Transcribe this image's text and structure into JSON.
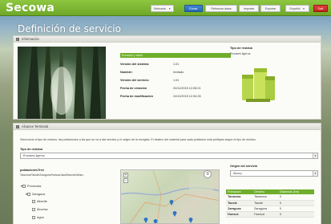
{
  "app": {
    "logo": "Secowa",
    "user_select": "Selección",
    "buttons": {
      "enviar": "Enviar",
      "refrescar": "Refrescar datos",
      "importar": "Importar",
      "exportar": "Exportar",
      "salir": "Salir"
    },
    "language": "Español"
  },
  "page": {
    "title": "Definición de servicio"
  },
  "info_panel": {
    "header": "Información",
    "highlight_row": "Envases y vidrio",
    "rows": [
      {
        "label": "Versión del sistema",
        "value": "1.01"
      },
      {
        "label": "Nombre:",
        "value": "Invitado"
      },
      {
        "label": "Versión del servicio",
        "value": "1.01"
      },
      {
        "label": "Fecha de creación",
        "value": "24/11/2015 12:28:21"
      },
      {
        "label": "Fecha de modificación",
        "value": "24/11/2015 12:34:26"
      }
    ],
    "waste_type_label": "Tipo de residuo",
    "waste_type_value": "Envases ligeros"
  },
  "territorial_panel": {
    "header": "Alcance Territorial",
    "instructions": "Seleccione el tipo de residuo, las poblaciones a las que se va a dar servicio y el origen de la recogida. El destino del material para cada población está prefijado según el tipo de residuo",
    "waste_type_label": "Tipo de residuo",
    "waste_type_value": "Envases ligeros",
    "origin_label": "Origen del servicio",
    "origin_value": "Alcorp",
    "tree_title": "poblacionesTree",
    "tree_path": "Tarazona/Tauste/Zaragoza/Huesca/Jaca/Monzón/Albarr...",
    "tree_items": [
      "Provincias",
      "Zaragoza",
      "Alberite",
      "Alcorisa",
      "Agón"
    ],
    "table": {
      "columns": [
        "Población",
        "Destino",
        "Distancia (km)"
      ],
      "rows": [
        [
          "Tarazona",
          "Tarazona",
          "0"
        ],
        [
          "Tauste",
          "Tauste",
          "0"
        ],
        [
          "Zaragoza",
          "Zaragoza",
          "0"
        ],
        [
          "Huesca",
          "Huesca",
          "0"
        ]
      ]
    }
  },
  "colors": {
    "topbar": "#7bb535",
    "accent_green": "#6fae2c",
    "button_blue": "#2f74c4",
    "button_red": "#d2302b"
  }
}
